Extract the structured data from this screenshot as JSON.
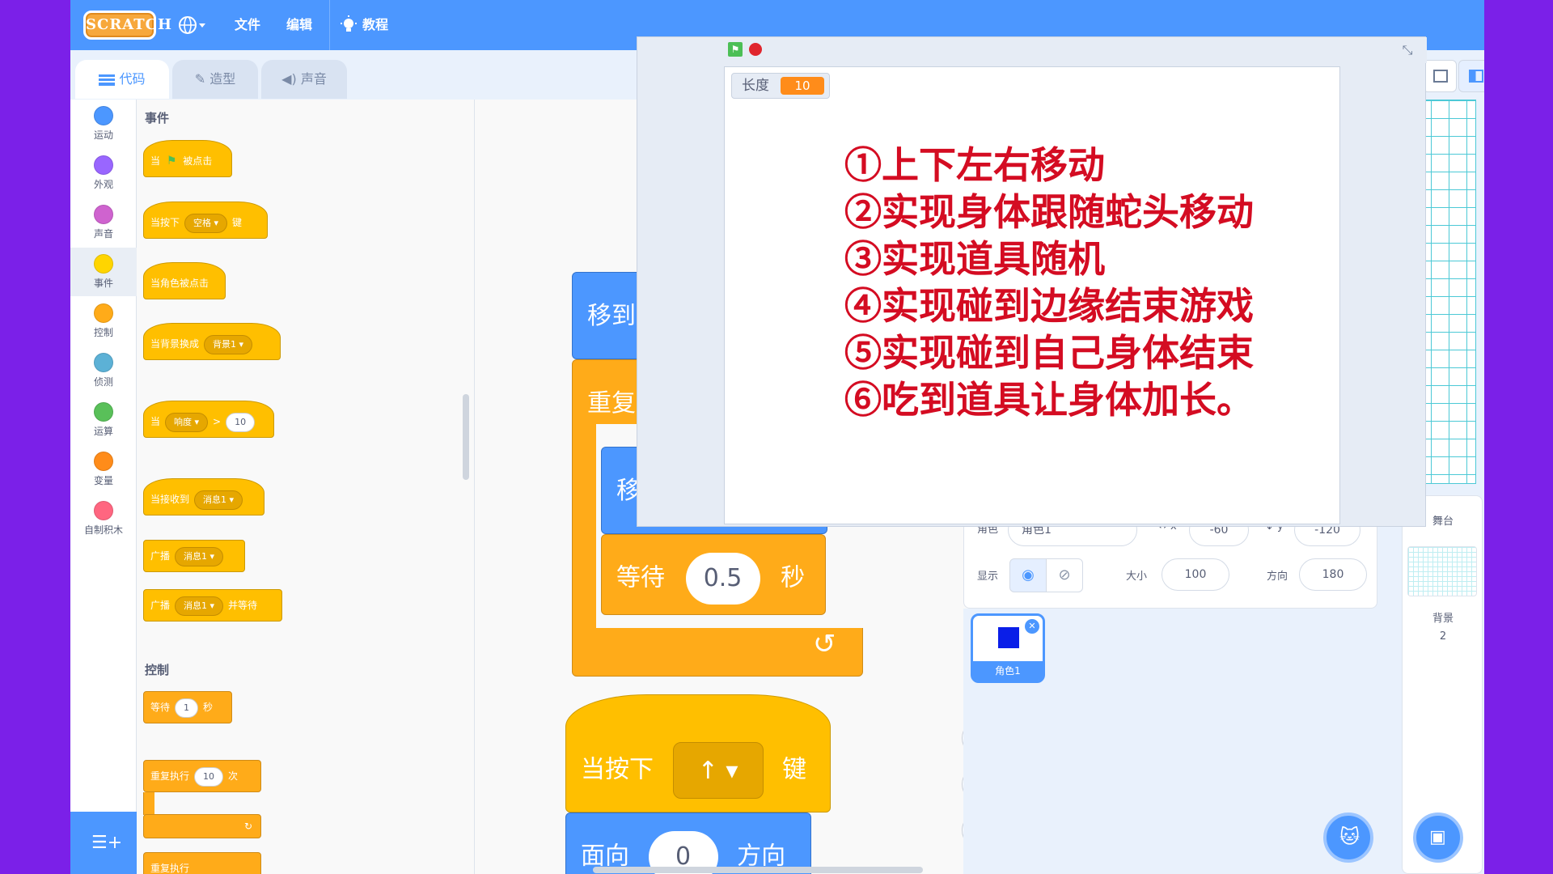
{
  "menubar": {
    "logo": "SCRATCH",
    "items": [
      "文件",
      "编辑"
    ],
    "tutorials": "教程"
  },
  "tabs": [
    "代码",
    "造型",
    "声音"
  ],
  "categories": [
    {
      "label": "运动",
      "color": "#4c97ff"
    },
    {
      "label": "外观",
      "color": "#9966ff"
    },
    {
      "label": "声音",
      "color": "#cf63cf"
    },
    {
      "label": "事件",
      "color": "#ffd500"
    },
    {
      "label": "控制",
      "color": "#ffab19"
    },
    {
      "label": "侦测",
      "color": "#5cb1d6"
    },
    {
      "label": "运算",
      "color": "#59c059"
    },
    {
      "label": "变量",
      "color": "#ff8c1a"
    },
    {
      "label": "自制积木",
      "color": "#ff6680"
    }
  ],
  "palette": {
    "events_title": "事件",
    "control_title": "控制",
    "b1": {
      "pre": "当",
      "post": "被点击"
    },
    "b2": {
      "pre": "当按下",
      "dd": "空格",
      "post": "键"
    },
    "b3": "当角色被点击",
    "b4": {
      "pre": "当背景换成",
      "dd": "背景1"
    },
    "b5": {
      "pre": "当",
      "dd": "响度",
      "op": ">",
      "val": "10"
    },
    "b6": {
      "pre": "当接收到",
      "dd": "消息1"
    },
    "b7": {
      "pre": "广播",
      "dd": "消息1"
    },
    "b8": {
      "pre": "广播",
      "dd": "消息1",
      "post": "并等待"
    },
    "c1": {
      "pre": "等待",
      "val": "1",
      "post": "秒"
    },
    "c2": {
      "pre": "重复执行",
      "val": "10",
      "post": "次"
    },
    "c3": "重复执行"
  },
  "code": {
    "move_to": "移到",
    "repeat": "重复",
    "move": "移",
    "wait": {
      "pre": "等待",
      "val": "0.5",
      "post": "秒"
    },
    "when_key": {
      "pre": "当按下",
      "key": "↑",
      "post": "键"
    },
    "point": {
      "pre": "面向",
      "val": "0",
      "post": "方向"
    }
  },
  "sprite_info": {
    "sprite_label": "角色",
    "sprite_name": "角色1",
    "x_label": "x",
    "x_value": "-60",
    "y_label": "y",
    "y_value": "-120",
    "show_label": "显示",
    "size_label": "大小",
    "size_value": "100",
    "dir_label": "方向",
    "dir_value": "180"
  },
  "sprite_list": [
    {
      "name": "角色1",
      "color": "#0a1ee8"
    }
  ],
  "stage_panel": {
    "title": "舞台",
    "backdrop_label": "背景",
    "backdrop_count": "2"
  },
  "overlay": {
    "variable_label": "长度",
    "variable_value": "10",
    "tasks": [
      "①上下左右移动",
      "②实现身体跟随蛇头移动",
      "③实现道具随机",
      "④实现碰到边缘结束游戏",
      "⑤实现碰到自己身体结束",
      "⑥吃到道具让身体加长。"
    ]
  },
  "colors": {
    "brand": "#4c97ff",
    "events": "#ffbf00",
    "control": "#ffab19",
    "task_text": "#d40c22",
    "background": "#7b20e8"
  }
}
